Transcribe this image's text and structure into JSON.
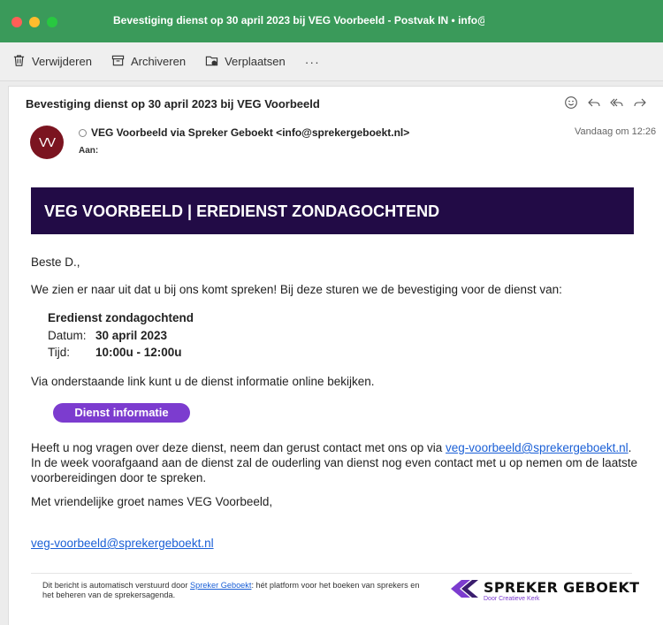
{
  "window": {
    "title": "Bevestiging dienst op 30 april 2023 bij VEG Voorbeeld - Postvak IN • info@",
    "accent": "#3a9a5a"
  },
  "toolbar": {
    "delete_label": "Verwijderen",
    "archive_label": "Archiveren",
    "move_label": "Verplaatsen",
    "more_label": "···"
  },
  "message": {
    "subject": "Bevestiging dienst op 30 april 2023 bij VEG Voorbeeld",
    "avatar_initials": "VV",
    "sender": "VEG Voorbeeld via Spreker Geboekt <info@sprekergeboekt.nl>",
    "to_label": "Aan:",
    "time": "Vandaag om 12:26"
  },
  "email": {
    "banner": "VEG VOORBEELD | EREDIENST ZONDAGOCHTEND",
    "greeting": "Beste D.,",
    "intro": "We zien er naar uit dat u bij ons komt spreken! Bij deze sturen we de bevestiging voor de dienst van:",
    "service_name": "Eredienst zondagochtend",
    "date_label": "Datum:",
    "date_value": "30 april 2023",
    "time_label": "Tijd:",
    "time_value": "10:00u - 12:00u",
    "link_intro": "Via onderstaande link kunt u de dienst informatie online bekijken.",
    "button_label": "Dienst informatie",
    "contact_pre": "Heeft u nog vragen over deze dienst, neem dan gerust contact met ons op via ",
    "contact_email": "veg-voorbeeld@sprekergeboekt.nl",
    "contact_post": ". In de week voorafgaand aan de dienst zal de ouderling van dienst nog even contact met u op nemen om de laatste voorbereidingen door te spreken.",
    "closing": "Met vriendelijke groet names VEG Voorbeeld,",
    "signature_email": "veg-voorbeeld@sprekergeboekt.nl",
    "footer_pre": "Dit bericht is automatisch verstuurd door ",
    "footer_link": "Spreker Geboekt",
    "footer_post": ": hét platform voor het boeken van sprekers en het beheren van de sprekersagenda.",
    "logo_text": "SPREKER GEBOEKT",
    "logo_sub": "Door Creatieve Kerk",
    "banner_color": "#220b46",
    "button_color": "#7c3ccf"
  }
}
